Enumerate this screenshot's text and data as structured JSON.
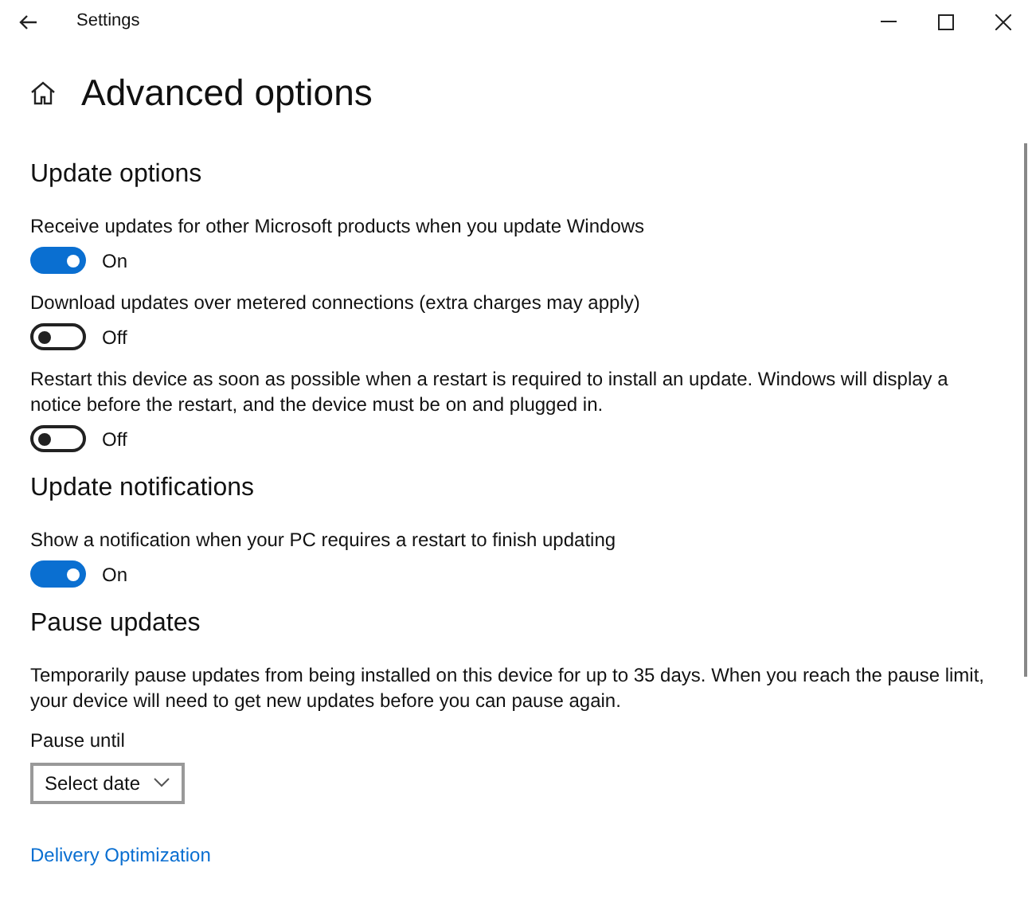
{
  "window": {
    "title": "Settings"
  },
  "page_title": "Advanced options",
  "sections": [
    {
      "title": "Update options",
      "items": [
        {
          "kind": "toggle",
          "label": "Receive updates for other Microsoft products when you update Windows",
          "on": true,
          "state_text": "On"
        },
        {
          "kind": "toggle",
          "label": "Download updates over metered connections (extra charges may apply)",
          "on": false,
          "state_text": "Off"
        },
        {
          "kind": "toggle",
          "label": "Restart this device as soon as possible when a restart is required to install an update. Windows will display a notice before the restart, and the device must be on and plugged in.",
          "on": false,
          "state_text": "Off"
        }
      ]
    },
    {
      "title": "Update notifications",
      "items": [
        {
          "kind": "toggle",
          "label": "Show a notification when your PC requires a restart to finish updating",
          "on": true,
          "state_text": "On"
        }
      ]
    },
    {
      "title": "Pause updates",
      "items": [
        {
          "kind": "text",
          "label": "Temporarily pause updates from being installed on this device for up to 35 days. When you reach the pause limit, your device will need to get new updates before you can pause again."
        },
        {
          "kind": "dropdown",
          "label": "Pause until",
          "value": "Select date"
        }
      ]
    }
  ],
  "link": "Delivery Optimization"
}
